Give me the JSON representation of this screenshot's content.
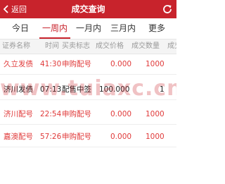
{
  "header": {
    "back_label": "返回",
    "title": "成交查询"
  },
  "tabs": [
    {
      "label": "今日",
      "active": false
    },
    {
      "label": "一周内",
      "active": true
    },
    {
      "label": "一月内",
      "active": false
    },
    {
      "label": "三月内",
      "active": false
    },
    {
      "label": "更多",
      "active": false
    }
  ],
  "columns": [
    "证券名称",
    "时间",
    "买卖标志",
    "成交价格",
    "成交数量",
    "成交金"
  ],
  "rows": [
    {
      "name": "久立发债",
      "time": "41:30",
      "flag": "申购配号",
      "price": "0.000",
      "qty": "1000",
      "color": "red"
    },
    {
      "name": "济川发债",
      "time": "07:13",
      "flag": "配售中签",
      "price": "100.000",
      "qty": "1",
      "color": "black"
    },
    {
      "name": "济川配号",
      "time": "22:54",
      "flag": "申购配号",
      "price": "0.000",
      "qty": "1000",
      "color": "red"
    },
    {
      "name": "嘉澳配号",
      "time": "57:26",
      "flag": "申购配号",
      "price": "0.000",
      "qty": "1000",
      "color": "red"
    }
  ],
  "watermark": "www.tuiaxc.cn",
  "colors": {
    "brand_red": "#c8232c",
    "row_red": "#e03a3a"
  },
  "icons": {
    "back": "chevron-left-icon",
    "refresh": "refresh-icon"
  }
}
